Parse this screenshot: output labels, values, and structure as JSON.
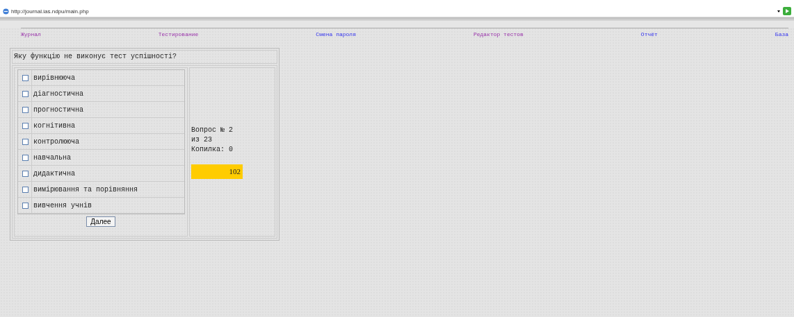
{
  "address_bar": {
    "url": "http://journal.ias.ndpu/main.php"
  },
  "nav": [
    {
      "label": "Журнал",
      "visited": true
    },
    {
      "label": "Тестирование",
      "visited": true
    },
    {
      "label": "Смена пароля",
      "visited": false
    },
    {
      "label": "Редактор тестов",
      "visited": true
    },
    {
      "label": "Отчёт",
      "visited": false
    },
    {
      "label": "База",
      "visited": false
    }
  ],
  "question": {
    "text": "Яку функцію не виконує тест успішності?",
    "options": [
      {
        "label": "вирівнююча",
        "checked": false
      },
      {
        "label": "діагностична",
        "checked": false
      },
      {
        "label": "прогностична",
        "checked": false
      },
      {
        "label": "когнітивна",
        "checked": false
      },
      {
        "label": "контролююча",
        "checked": false
      },
      {
        "label": "навчальна",
        "checked": false
      },
      {
        "label": "дидактична",
        "checked": false
      },
      {
        "label": "вимірювання та порівняння",
        "checked": false
      },
      {
        "label": "вивчення учнів",
        "checked": false
      }
    ],
    "next_button": "Далее"
  },
  "info": {
    "lines": [
      "Вопрос № 2",
      "из 23",
      "Копилка: 0"
    ],
    "timer": "102"
  }
}
